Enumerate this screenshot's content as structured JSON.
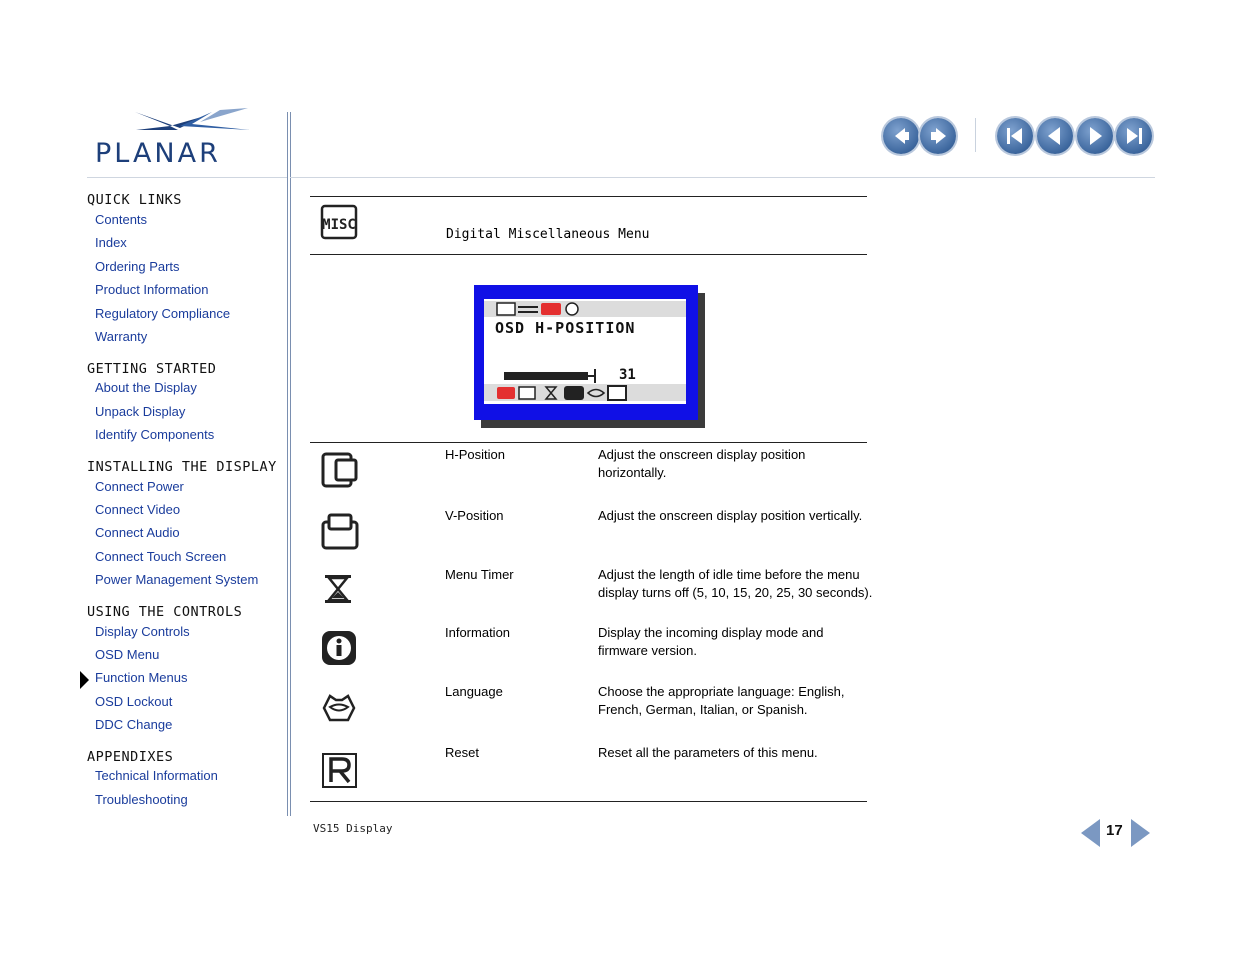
{
  "brand": {
    "logo_text": "PLANAR",
    "color": "#1d3f7a"
  },
  "sidebar": {
    "sections": [
      {
        "title": "QUICK LINKS",
        "items": [
          "Contents",
          "Index",
          "Ordering Parts",
          "Product Information",
          "Regulatory Compliance",
          "Warranty"
        ]
      },
      {
        "title": "GETTING STARTED",
        "items": [
          "About the Display",
          "Unpack Display",
          "Identify Components"
        ]
      },
      {
        "title": "INSTALLING THE DISPLAY",
        "items": [
          "Connect Power",
          "Connect Video",
          "Connect Audio",
          "Connect Touch Screen",
          "Power Management System"
        ]
      },
      {
        "title": "USING THE CONTROLS",
        "items": [
          "Display Controls",
          "OSD Menu",
          "Function Menus",
          "OSD Lockout",
          "DDC Change"
        ]
      },
      {
        "title": "APPENDIXES",
        "items": [
          "Technical Information",
          "Troubleshooting"
        ]
      }
    ],
    "current_item": "Function Menus"
  },
  "nav": {
    "buttons": [
      "back-icon",
      "forward-icon",
      "first-page-icon",
      "previous-page-icon",
      "next-page-icon",
      "last-page-icon"
    ]
  },
  "content": {
    "menu_icon": "MISC",
    "menu_title": "Digital Miscellaneous Menu",
    "osd": {
      "title": "OSD H-POSITION",
      "value": "31",
      "level_fraction": 0.31
    },
    "rows": [
      {
        "icon": "h-position-icon",
        "name": "H-Position",
        "description": "Adjust the onscreen display position horizontally."
      },
      {
        "icon": "v-position-icon",
        "name": "V-Position",
        "description": "Adjust the onscreen display position vertically."
      },
      {
        "icon": "hourglass-icon",
        "name": "Menu Timer",
        "description": "Adjust the length of idle time before the menu display turns off (5, 10, 15, 20, 25, 30 seconds)."
      },
      {
        "icon": "information-icon",
        "name": "Information",
        "description": "Display the incoming display mode and firmware version."
      },
      {
        "icon": "language-icon",
        "name": "Language",
        "description": "Choose the appropriate language: English, French, German, Italian, or Spanish."
      },
      {
        "icon": "reset-icon",
        "name": "Reset",
        "description": "Reset all the parameters of this menu."
      }
    ]
  },
  "footer": {
    "doc_title": "VS15 Display",
    "page_number": "17"
  }
}
